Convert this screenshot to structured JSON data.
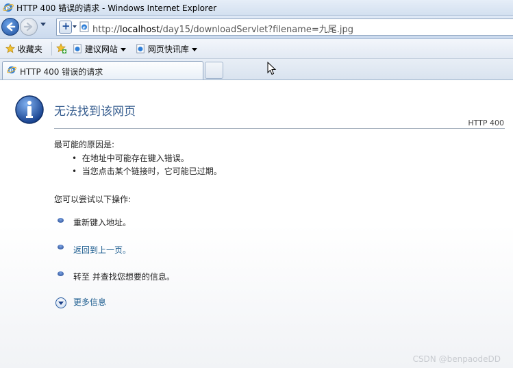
{
  "window": {
    "title": "HTTP 400 错误的请求 - Windows Internet Explorer"
  },
  "address": {
    "prefix": "http://",
    "host": "localhost",
    "path": "/day15/downloadServlet?filename=九尾.jpg"
  },
  "favorites": {
    "label": "收藏夹",
    "suggested_sites": "建议网站",
    "web_slice": "网页快讯库"
  },
  "tab": {
    "title": "HTTP 400 错误的请求"
  },
  "error": {
    "heading": "无法找到该网页",
    "code": "HTTP 400",
    "causes_title": "最可能的原因是:",
    "causes": [
      "在地址中可能存在键入错误。",
      "当您点击某个链接时，它可能已过期。"
    ],
    "try_title": "您可以尝试以下操作:",
    "actions": [
      "重新键入地址。",
      "返回到上一页。",
      "转至  并查找您想要的信息。"
    ],
    "more_info": "更多信息"
  },
  "watermark": "CSDN @benpaodeDD",
  "icons": [
    "ie-icon",
    "back-icon",
    "forward-icon",
    "compat-shield-icon",
    "page-icon",
    "star-icon",
    "add-favorites-icon",
    "info-icon",
    "more-info-icon",
    "cursor-icon"
  ]
}
